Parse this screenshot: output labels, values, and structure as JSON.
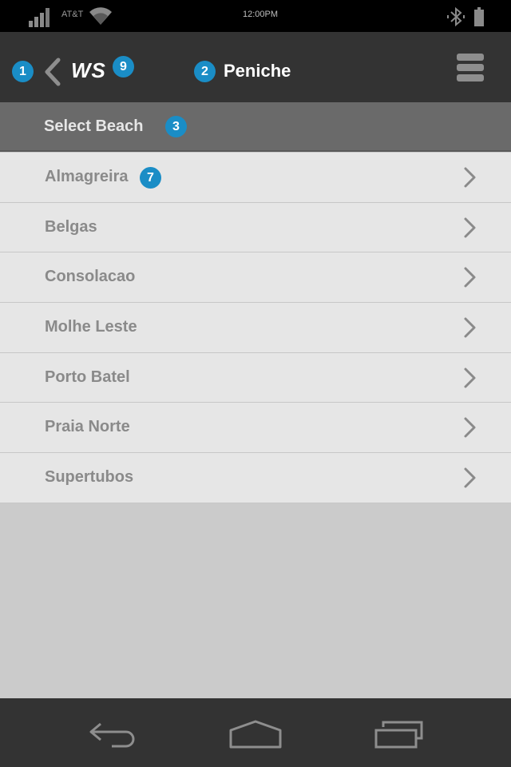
{
  "status_bar": {
    "carrier": "AT&T",
    "time": "12:00PM"
  },
  "header": {
    "brand": "WS",
    "title": "Peniche"
  },
  "annotations": {
    "back": "1",
    "title": "2",
    "section": "3",
    "first_item": "7",
    "brand": "9"
  },
  "section": {
    "title": "Select Beach"
  },
  "beaches": [
    {
      "name": "Almagreira"
    },
    {
      "name": "Belgas"
    },
    {
      "name": "Consolacao"
    },
    {
      "name": "Molhe Leste"
    },
    {
      "name": "Porto Batel"
    },
    {
      "name": "Praia Norte"
    },
    {
      "name": "Supertubos"
    }
  ],
  "icons": {
    "back": "chevron-left-icon",
    "menu": "hamburger-menu-icon",
    "row": "chevron-right-icon",
    "nav": [
      "back-arrow-icon",
      "home-icon",
      "recent-apps-icon"
    ]
  },
  "colors": {
    "accent": "#1a8dc6",
    "header": "#333333",
    "section": "#6a6a6a",
    "list_bg": "#e6e6e6",
    "page_bg": "#cbcbcb"
  }
}
